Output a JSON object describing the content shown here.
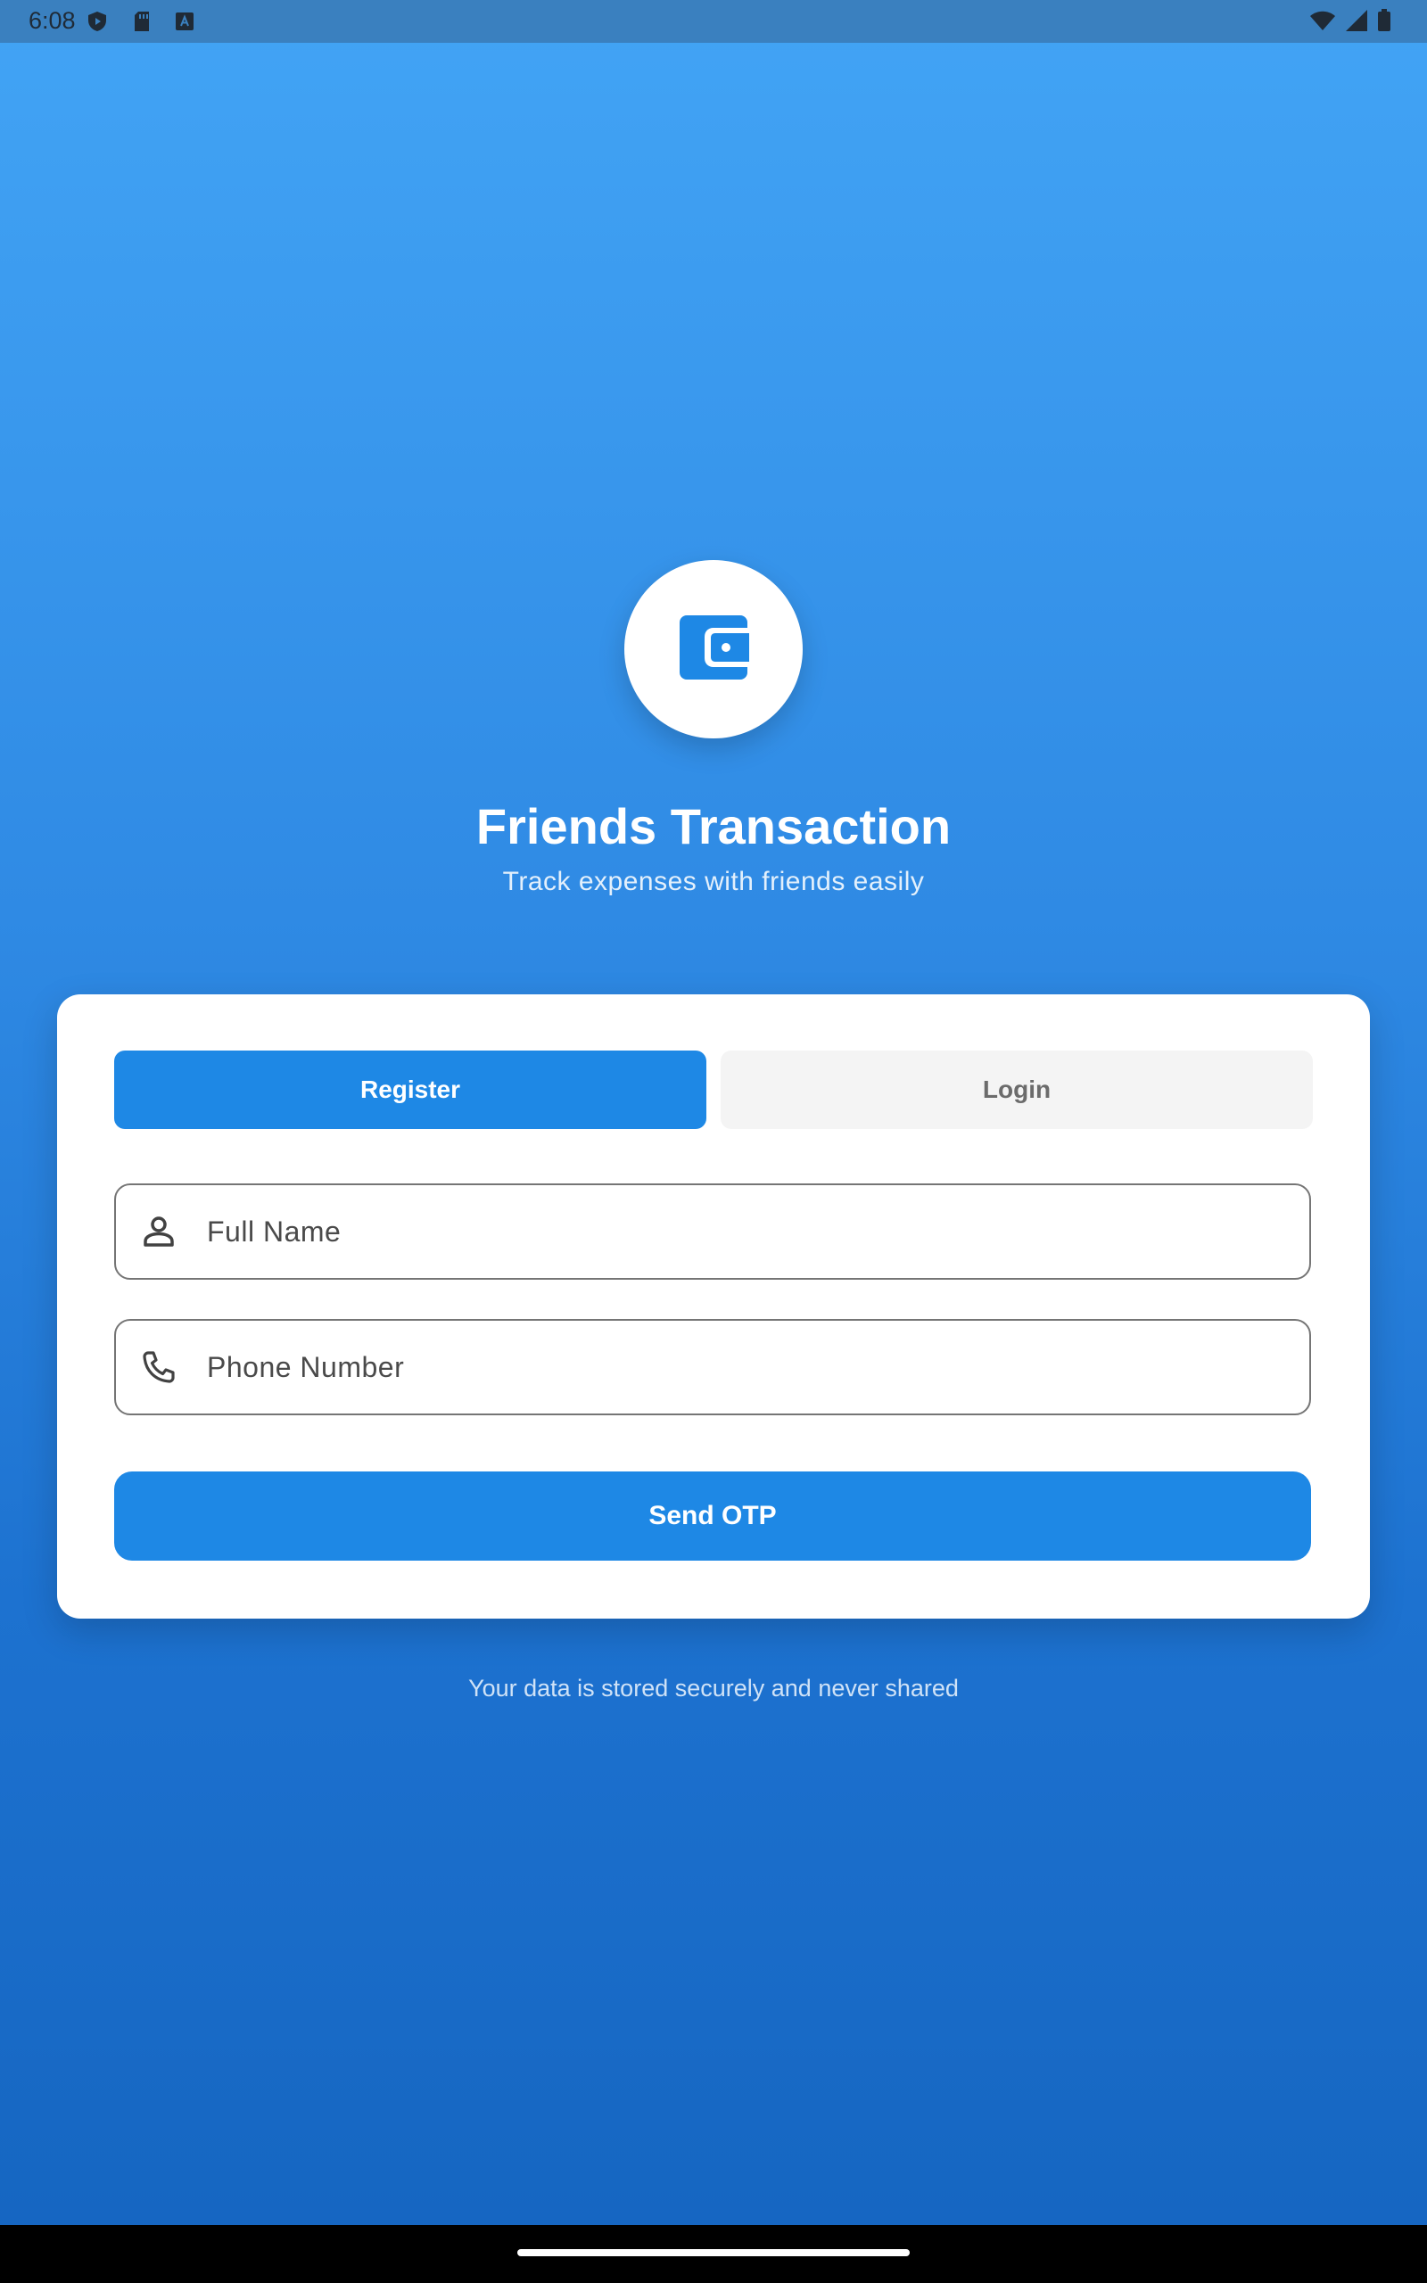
{
  "status_bar": {
    "time": "6:08",
    "left_icons": [
      "shield-play-icon",
      "sd-card-icon",
      "a-box-icon"
    ],
    "right_icons": [
      "wifi-icon",
      "signal-icon",
      "battery-icon"
    ]
  },
  "header": {
    "logo_icon": "wallet-icon",
    "title": "Friends Transaction",
    "subtitle": "Track expenses with friends easily"
  },
  "tabs": [
    {
      "label": "Register",
      "active": true
    },
    {
      "label": "Login",
      "active": false
    }
  ],
  "form": {
    "full_name": {
      "placeholder": "Full Name",
      "value": "",
      "icon": "person-icon"
    },
    "phone": {
      "placeholder": "Phone Number",
      "value": "",
      "icon": "phone-icon"
    },
    "submit_label": "Send OTP"
  },
  "footnote": "Your data is stored securely and never shared",
  "colors": {
    "primary": "#1e88e5",
    "gradient_top": "#42a4f5",
    "gradient_bottom": "#1565c0",
    "tab_inactive_bg": "#f4f4f4"
  }
}
